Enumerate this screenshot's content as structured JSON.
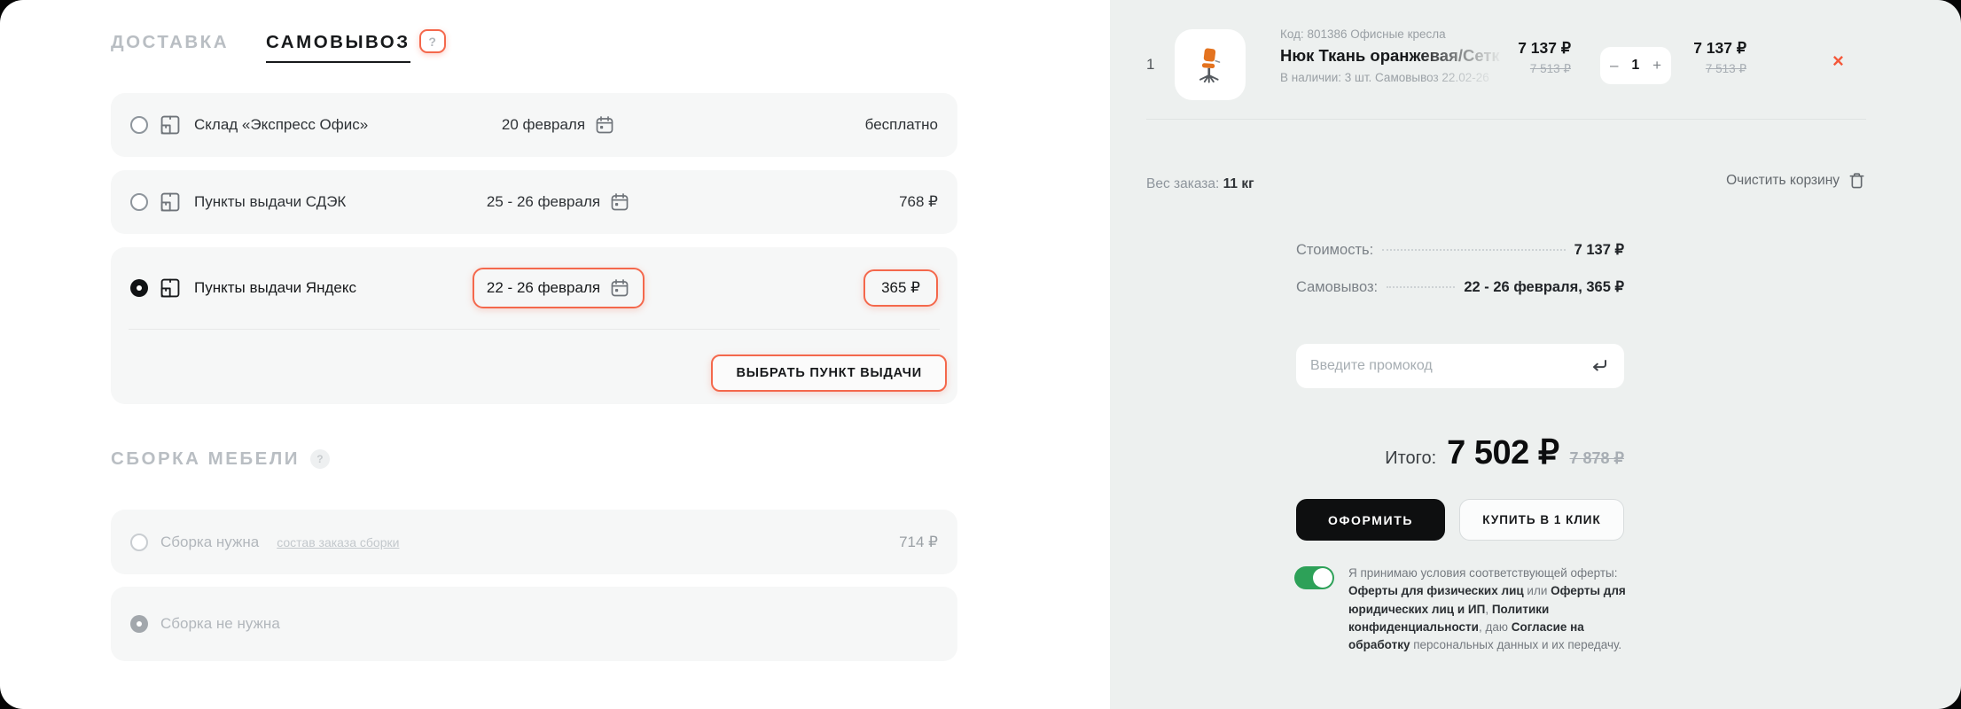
{
  "accent": "#f4684c",
  "tabs": {
    "delivery": "ДОСТАВКА",
    "pickup": "САМОВЫВОЗ",
    "help": "?"
  },
  "delivery": {
    "options": [
      {
        "label": "Склад «Экспресс Офис»",
        "date": "20 февраля",
        "price": "бесплатно"
      },
      {
        "label": "Пункты выдачи СДЭК",
        "date": "25 - 26 февраля",
        "price": "768 ₽"
      },
      {
        "label": "Пункты выдачи Яндекс",
        "date": "22 - 26 февраля",
        "price": "365 ₽"
      }
    ],
    "choose_button": "ВЫБРАТЬ ПУНКТ ВЫДАЧИ"
  },
  "assembly": {
    "title": "СБОРКА МЕБЕЛИ",
    "help": "?",
    "options": [
      {
        "label": "Сборка нужна",
        "link": "состав заказа сборки",
        "price": "714 ₽"
      },
      {
        "label": "Сборка не нужна"
      }
    ]
  },
  "cart": {
    "item": {
      "index": "1",
      "code": "Код: 801386 Офисные кресла",
      "title": "Нюк Ткань оранжевая/Сетк",
      "stock": "В наличии: 3 шт. Самовывоз 22.02-26",
      "price": "7 137 ₽",
      "old_price": "7 513 ₽",
      "minus": "–",
      "qty": "1",
      "plus": "+",
      "total": "7 137 ₽",
      "old_total": "7 513 ₽",
      "remove": "×"
    },
    "weight_label": "Вес заказа:",
    "weight_value": "11 кг",
    "clear_label": "Очистить корзину",
    "summary": [
      {
        "label": "Стоимость:",
        "value": "7 137 ₽"
      },
      {
        "label": "Самовывоз:",
        "value": "22 - 26 февраля, 365 ₽"
      }
    ],
    "promo_placeholder": "Введите промокод",
    "total_label": "Итого:",
    "total_value": "7 502 ₽",
    "total_old": "7 878 ₽",
    "checkout": "ОФОРМИТЬ",
    "one_click": "КУПИТЬ В 1 КЛИК",
    "legal": [
      {
        "text": "Я принимаю условия соответствующей оферты: "
      },
      {
        "text": "Оферты для физических лиц",
        "bold": true
      },
      {
        "text": " или "
      },
      {
        "text": "Оферты для юридических лиц и ИП",
        "bold": true
      },
      {
        "text": ", "
      },
      {
        "text": "Политики конфиденциальности",
        "bold": true
      },
      {
        "text": ", даю "
      },
      {
        "text": "Согласие на обработку",
        "bold": true
      },
      {
        "text": " персональных данных и их передачу."
      }
    ]
  }
}
